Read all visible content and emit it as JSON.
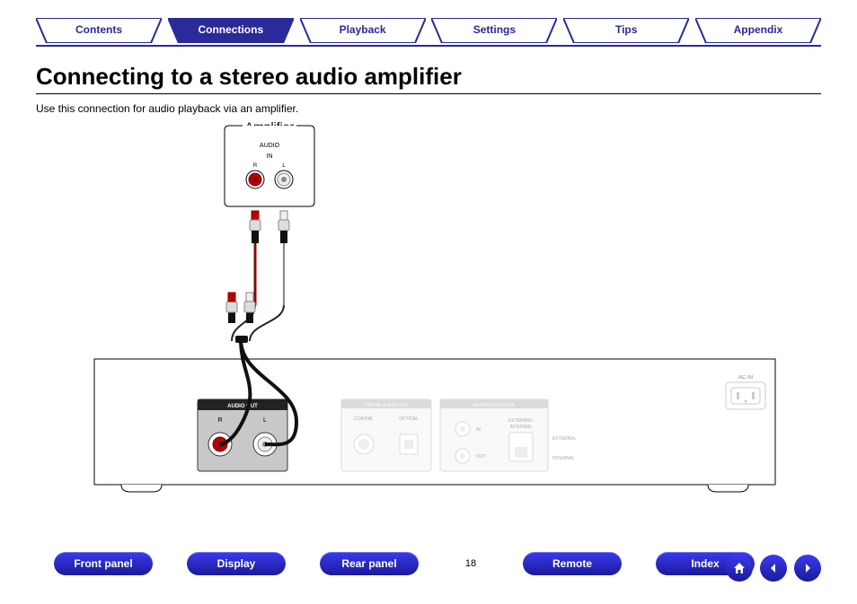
{
  "tabs": {
    "items": [
      {
        "label": "Contents",
        "active": false
      },
      {
        "label": "Connections",
        "active": true
      },
      {
        "label": "Playback",
        "active": false
      },
      {
        "label": "Settings",
        "active": false
      },
      {
        "label": "Tips",
        "active": false
      },
      {
        "label": "Appendix",
        "active": false
      }
    ]
  },
  "page": {
    "title": "Connecting to a stereo audio amplifier",
    "description": "Use this connection for audio playback via an amplifier.",
    "number": "18"
  },
  "diagram": {
    "amplifier_label": "Amplifier",
    "amp_audio": "AUDIO",
    "amp_in": "IN",
    "amp_r": "R",
    "amp_l": "L",
    "device_audio_out": "AUDIO OUT",
    "device_r": "R",
    "device_l": "L",
    "device_digital": "DIGITAL AUDIO OUT",
    "device_coaxial": "COAXIAL",
    "device_optical": "OPTICAL",
    "device_remote": "REMOTE CONTROL",
    "device_rc_in": "IN",
    "device_rc_out": "OUT",
    "device_rc_ext": "EXTERNAL",
    "device_rc_int": "INTERNAL",
    "device_rc_switch": "EXTERNAL/\nINTERNAL",
    "device_acin": "AC IN"
  },
  "footer": {
    "buttons": [
      "Front panel",
      "Display",
      "Rear panel",
      "Remote",
      "Index"
    ]
  }
}
